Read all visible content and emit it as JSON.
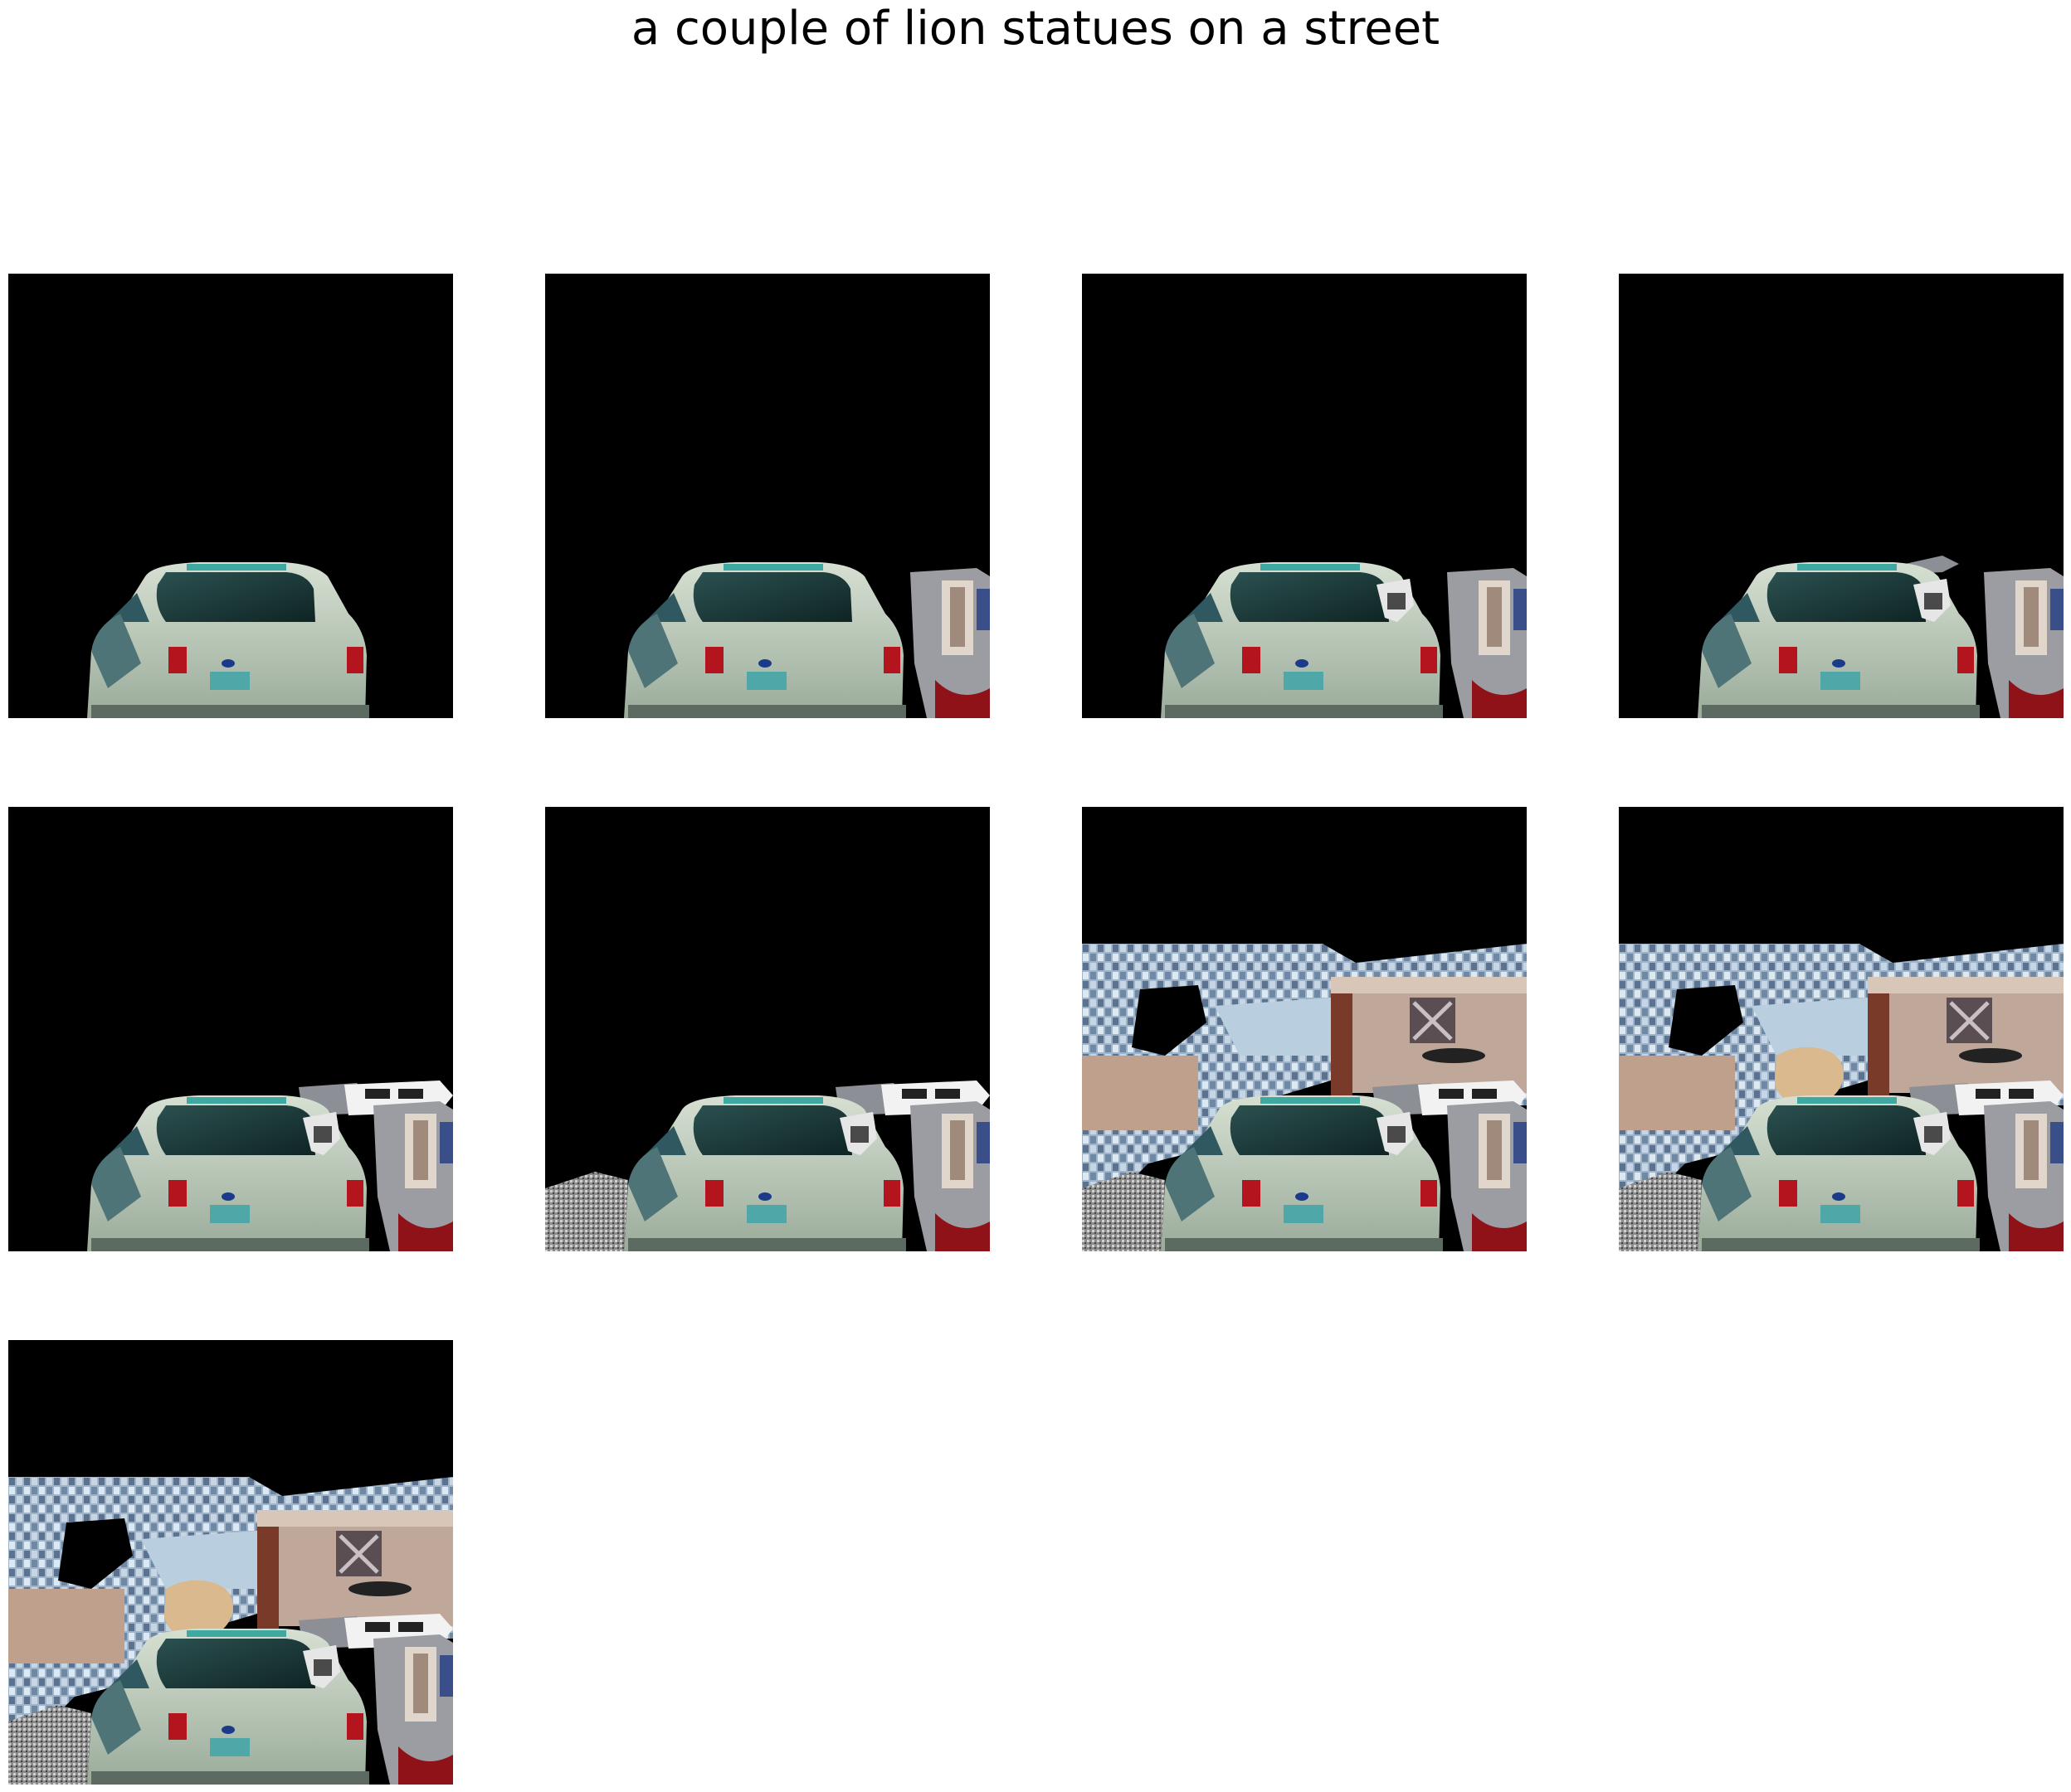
{
  "title": "a couple of lion statues on a street",
  "panels": [
    {
      "index": 1,
      "layers": [
        "car"
      ]
    },
    {
      "index": 2,
      "layers": [
        "car",
        "right-vehicle"
      ]
    },
    {
      "index": 3,
      "layers": [
        "car",
        "right-vehicle",
        "side-mirror"
      ]
    },
    {
      "index": 4,
      "layers": [
        "car",
        "right-vehicle",
        "side-mirror",
        "rooftop-patch"
      ]
    },
    {
      "index": 5,
      "layers": [
        "car",
        "right-vehicle",
        "side-mirror",
        "white-suv"
      ]
    },
    {
      "index": 6,
      "layers": [
        "car",
        "right-vehicle",
        "side-mirror",
        "white-suv",
        "gravel"
      ]
    },
    {
      "index": 7,
      "layers": [
        "car",
        "right-vehicle",
        "side-mirror",
        "white-suv",
        "gravel",
        "street-buildings"
      ]
    },
    {
      "index": 8,
      "layers": [
        "car",
        "right-vehicle",
        "side-mirror",
        "white-suv",
        "gravel",
        "street-buildings",
        "tan-object"
      ]
    },
    {
      "index": 9,
      "layers": [
        "car",
        "right-vehicle",
        "side-mirror",
        "white-suv",
        "gravel",
        "street-buildings",
        "tan-object"
      ]
    }
  ],
  "colors": {
    "background": "#000000",
    "car_body": "#b9c7b8",
    "car_glass": "#1e3a3a",
    "taillight": "#b3141e",
    "plate": "#4fa7a8"
  }
}
